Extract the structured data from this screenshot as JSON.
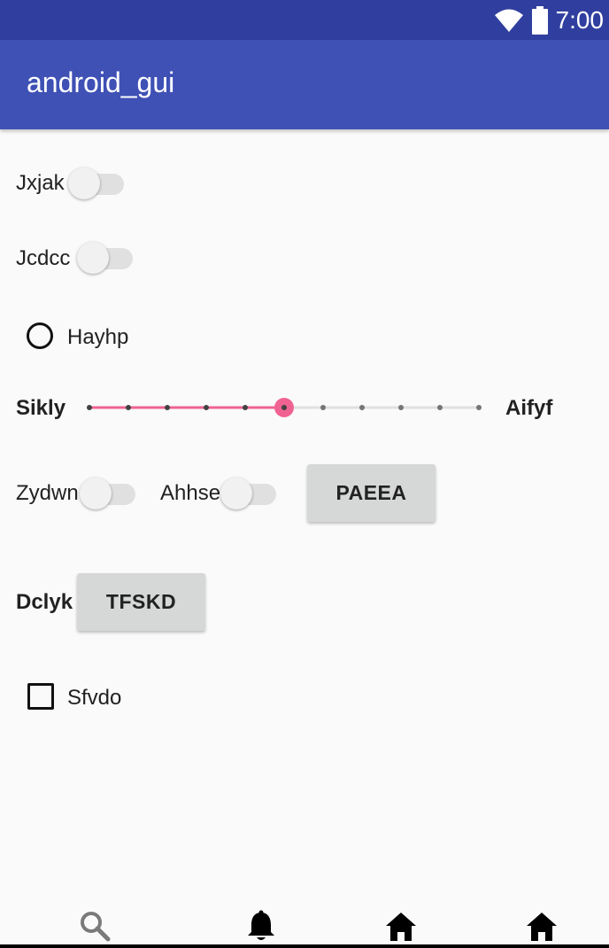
{
  "status_bar": {
    "time": "7:00",
    "icons": [
      "wifi-icon",
      "battery-icon"
    ],
    "color": "#303f9f"
  },
  "app_bar": {
    "title": "android_gui",
    "color": "#3f51b5"
  },
  "controls": {
    "switch_1_label": "Jxjak",
    "switch_2_label": "Jcdcc",
    "radio_label": "Hayhp",
    "slider_left_label": "Sikly",
    "slider_right_label": "Aifyf",
    "slider_value": 5,
    "slider_max": 10,
    "slider_accent": "#f06292",
    "switch_3_label": "Zydwn",
    "switch_4_label": "Ahhse",
    "button_1_label": "PAEEA",
    "button_2_prefix_label": "Dclyk",
    "button_2_label": "TFSKD",
    "checkbox_label": "Sfvdo"
  },
  "bottom_nav": {
    "icons": [
      "search-icon",
      "bell-icon",
      "home-icon",
      "home-icon"
    ]
  }
}
